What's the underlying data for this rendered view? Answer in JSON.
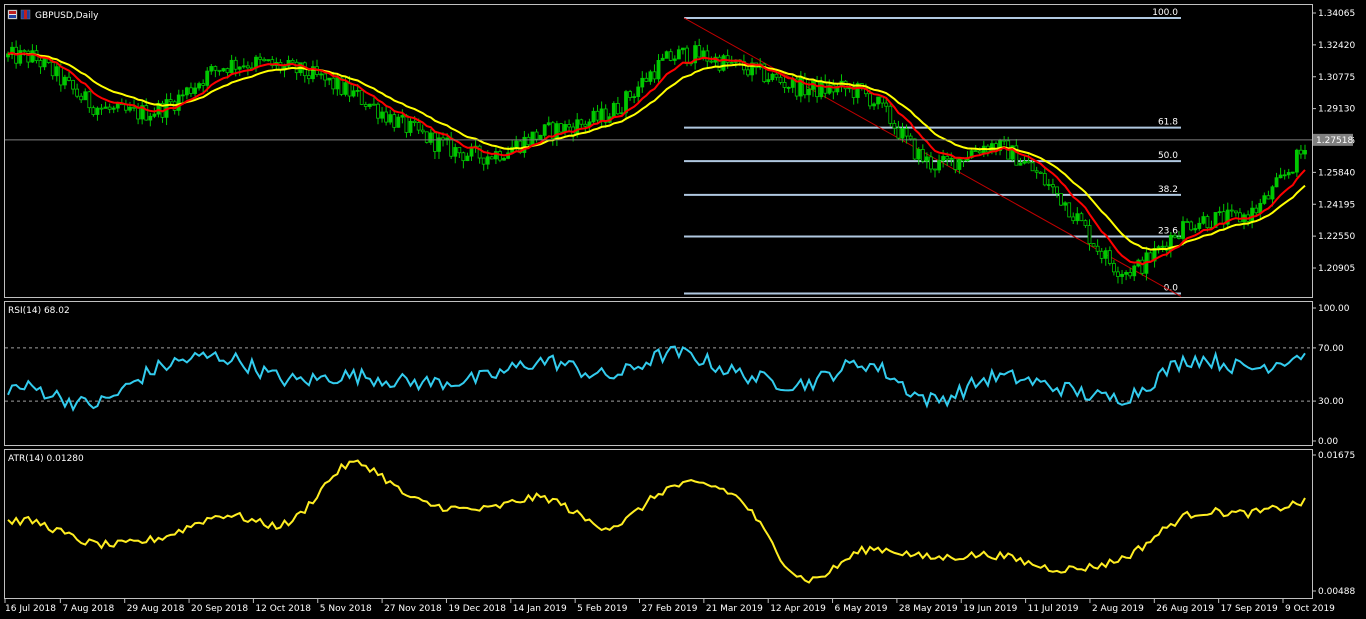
{
  "window": {
    "symbol_label": "GBPUSD,Daily"
  },
  "colors": {
    "background": "#000000",
    "border": "#c0c0c0",
    "candle": "#00c800",
    "ma_fast": "#ff0000",
    "ma_slow": "#ffff00",
    "fib": "#b0c8e0",
    "trendline": "#c00000",
    "rsi": "#33ccee",
    "atr": "#ffee22"
  },
  "price_panel": {
    "ticks": [
      "1.34065",
      "1.32420",
      "1.30775",
      "1.29130",
      "1.27485",
      "1.25840",
      "1.24195",
      "1.22550",
      "1.20905"
    ],
    "current_price": "1.27518"
  },
  "fibonacci": {
    "levels": [
      {
        "label": "100.0",
        "value": 1.3381
      },
      {
        "label": "61.8",
        "value": 1.2815
      },
      {
        "label": "50.0",
        "value": 1.2642
      },
      {
        "label": "38.2",
        "value": 1.2468
      },
      {
        "label": "23.6",
        "value": 1.2253
      },
      {
        "label": "0.0",
        "value": 1.1959
      }
    ]
  },
  "rsi_panel": {
    "label": "RSI(14) 68.02",
    "ticks": [
      "100.00",
      "70.00",
      "30.00",
      "0.00"
    ]
  },
  "atr_panel": {
    "label": "ATR(14) 0.01280",
    "ticks": [
      "0.01675",
      "0.00488"
    ]
  },
  "time_axis": {
    "labels": [
      "16 Jul 2018",
      "7 Aug 2018",
      "29 Aug 2018",
      "20 Sep 2018",
      "12 Oct 2018",
      "5 Nov 2018",
      "27 Nov 2018",
      "19 Dec 2018",
      "14 Jan 2019",
      "5 Feb 2019",
      "27 Feb 2019",
      "21 Mar 2019",
      "12 Apr 2019",
      "6 May 2019",
      "28 May 2019",
      "19 Jun 2019",
      "11 Jul 2019",
      "2 Aug 2019",
      "26 Aug 2019",
      "17 Sep 2019",
      "9 Oct 2019"
    ]
  },
  "chart_data": [
    {
      "type": "candlestick",
      "title": "GBPUSD,Daily",
      "ylim": [
        1.1959,
        1.3438
      ],
      "x": [
        "16 Jul 2018",
        "7 Aug 2018",
        "29 Aug 2018",
        "20 Sep 2018",
        "12 Oct 2018",
        "5 Nov 2018",
        "27 Nov 2018",
        "19 Dec 2018",
        "14 Jan 2019",
        "5 Feb 2019",
        "27 Feb 2019",
        "21 Mar 2019",
        "12 Apr 2019",
        "6 May 2019",
        "28 May 2019",
        "19 Jun 2019",
        "11 Jul 2019",
        "2 Aug 2019",
        "26 Aug 2019",
        "17 Sep 2019",
        "9 Oct 2019"
      ],
      "series": [
        {
          "values": [
            1.318,
            1.293,
            1.291,
            1.313,
            1.312,
            1.299,
            1.279,
            1.267,
            1.279,
            1.289,
            1.318,
            1.313,
            1.302,
            1.298,
            1.263,
            1.272,
            1.246,
            1.208,
            1.232,
            1.238,
            1.275
          ]
        }
      ]
    },
    {
      "type": "line",
      "title": "RSI(14) 68.02",
      "ylim": [
        0,
        100
      ],
      "x": [
        "16 Jul 2018",
        "7 Aug 2018",
        "29 Aug 2018",
        "20 Sep 2018",
        "12 Oct 2018",
        "5 Nov 2018",
        "27 Nov 2018",
        "19 Dec 2018",
        "14 Jan 2019",
        "5 Feb 2019",
        "27 Feb 2019",
        "21 Mar 2019",
        "12 Apr 2019",
        "6 May 2019",
        "28 May 2019",
        "19 Jun 2019",
        "11 Jul 2019",
        "2 Aug 2019",
        "26 Aug 2019",
        "17 Sep 2019",
        "9 Oct 2019"
      ],
      "series": [
        {
          "values": [
            40,
            28,
            55,
            63,
            46,
            49,
            44,
            47,
            60,
            49,
            66,
            51,
            43,
            58,
            31,
            48,
            40,
            33,
            61,
            55,
            68
          ]
        }
      ]
    },
    {
      "type": "line",
      "title": "ATR(14) 0.01280",
      "ylim": [
        0.00488,
        0.01675
      ],
      "x": [
        "16 Jul 2018",
        "7 Aug 2018",
        "29 Aug 2018",
        "20 Sep 2018",
        "12 Oct 2018",
        "5 Nov 2018",
        "27 Nov 2018",
        "19 Dec 2018",
        "14 Jan 2019",
        "5 Feb 2019",
        "27 Feb 2019",
        "21 Mar 2019",
        "12 Apr 2019",
        "6 May 2019",
        "28 May 2019",
        "19 Jun 2019",
        "11 Jul 2019",
        "2 Aug 2019",
        "26 Aug 2019",
        "17 Sep 2019",
        "9 Oct 2019"
      ],
      "series": [
        {
          "values": [
            0.011,
            0.009,
            0.0095,
            0.0115,
            0.0108,
            0.016,
            0.0128,
            0.012,
            0.013,
            0.0105,
            0.014,
            0.013,
            0.006,
            0.0085,
            0.0078,
            0.008,
            0.0068,
            0.0078,
            0.0115,
            0.0117,
            0.0128
          ]
        }
      ]
    }
  ]
}
